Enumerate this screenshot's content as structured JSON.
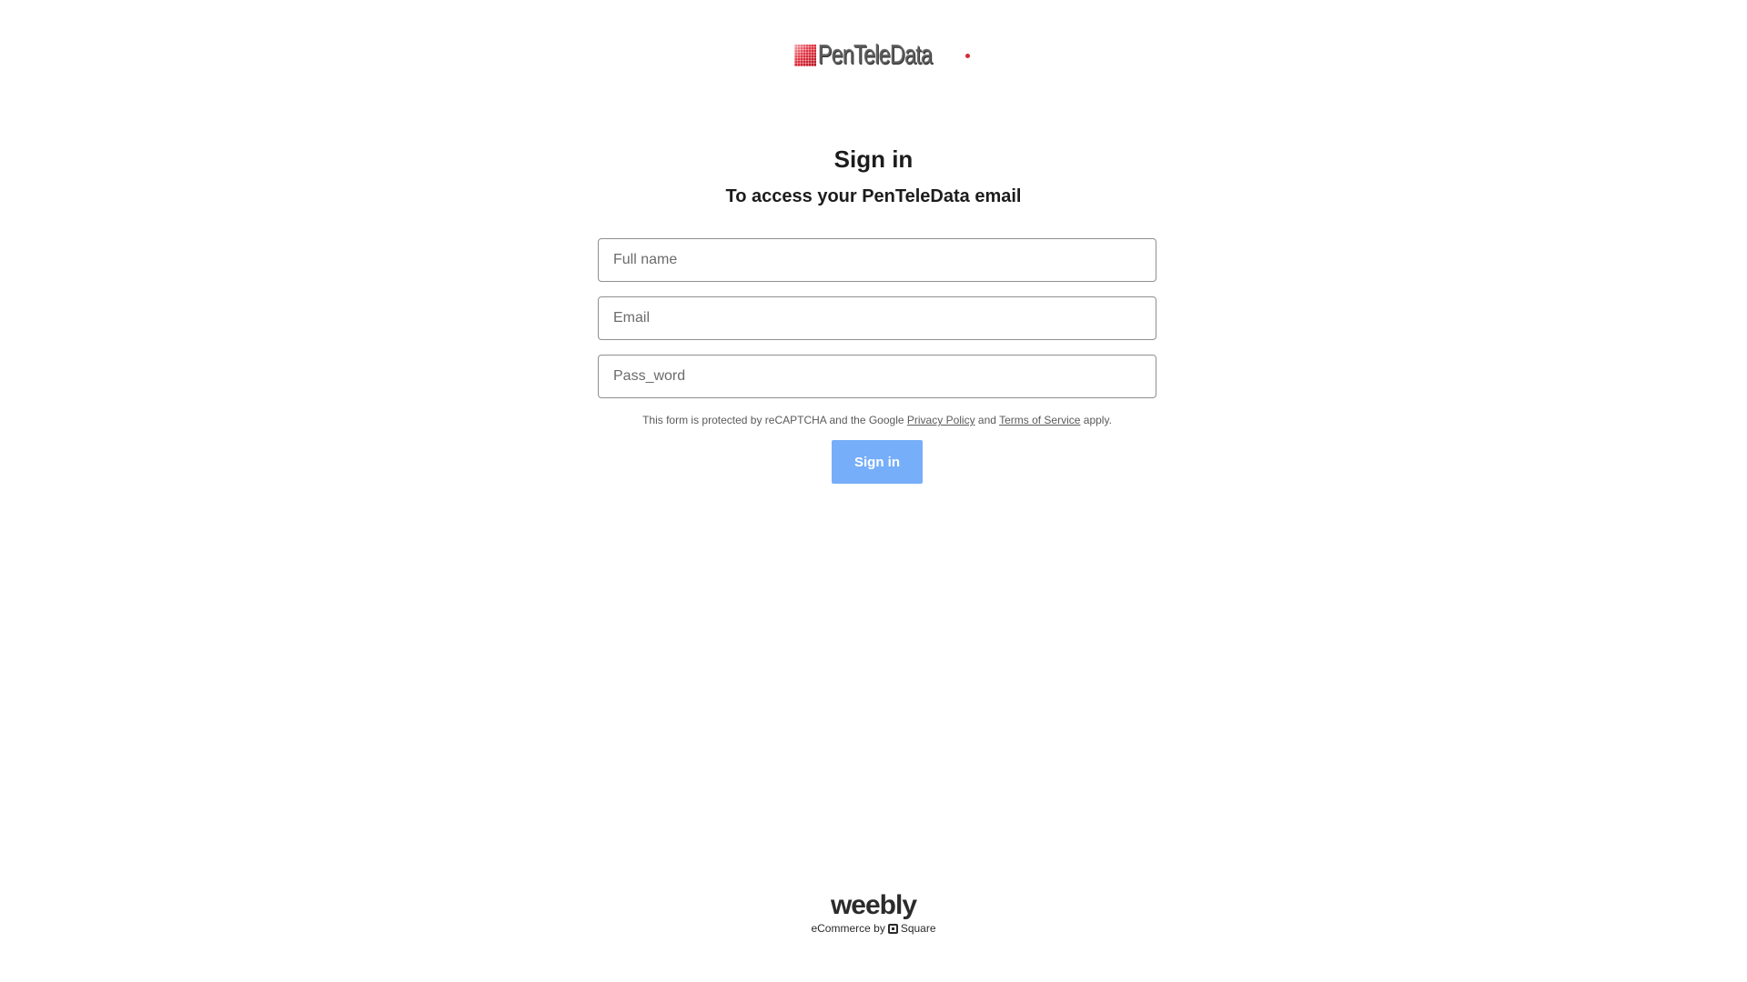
{
  "brand": {
    "logo_text": "PenTeleData"
  },
  "heading": {
    "title": "Sign in",
    "subtitle": "To access your PenTeleData email"
  },
  "form": {
    "full_name_placeholder": "Full name",
    "email_placeholder": "Email",
    "password_placeholder": "Pass_word",
    "legal_prefix": "This form is protected by reCAPTCHA and the Google",
    "privacy_link": "Privacy Policy",
    "legal_and": "and",
    "terms_link": "Terms of Service",
    "legal_suffix": "apply.",
    "submit_label": "Sign in"
  },
  "footer": {
    "weebly": "weebly",
    "ecommerce_prefix": "eCommerce by",
    "square": "Square"
  },
  "colors": {
    "button_bg": "#76aefa",
    "logo_red": "#d42a37",
    "text_dark": "#1c1c1c"
  }
}
